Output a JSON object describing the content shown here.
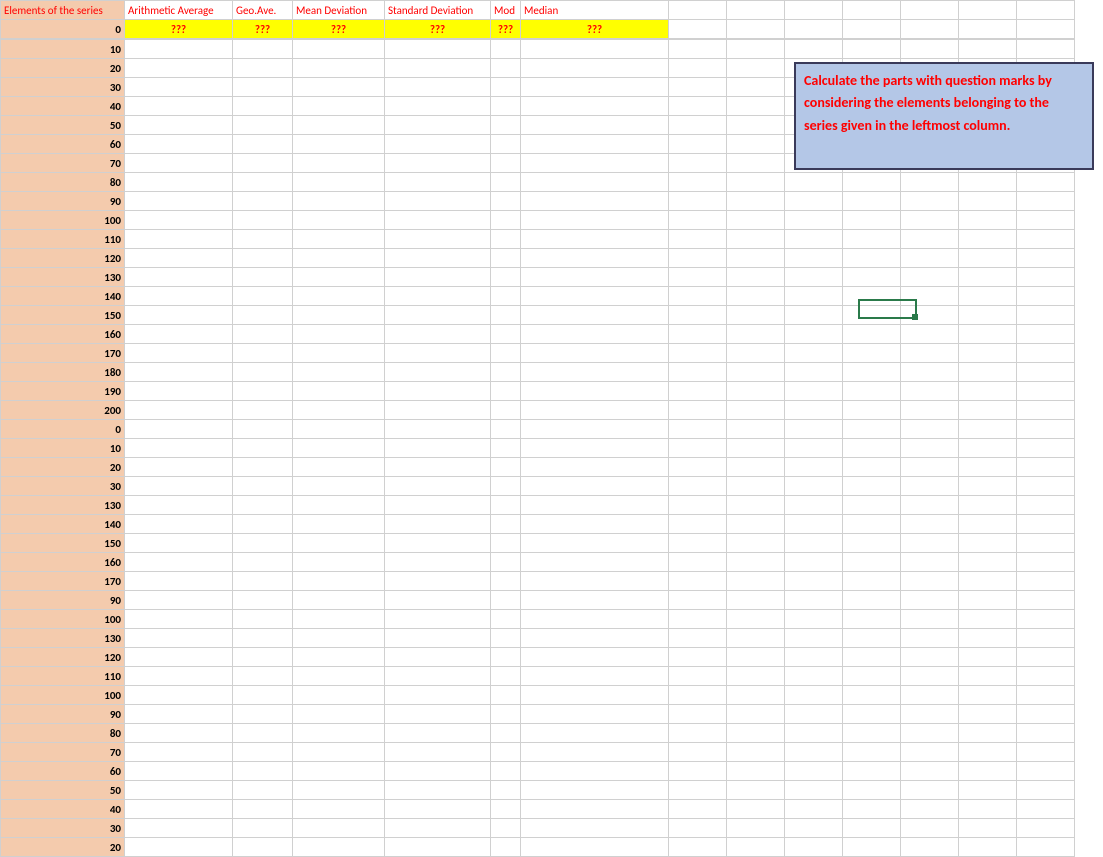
{
  "headers": {
    "col_a": "Elements of the series",
    "col_b": "Arithmetic Average",
    "col_c": "Geo.Ave.",
    "col_d": "Mean Deviation",
    "col_e": "Standard Deviation",
    "col_f": "Mod",
    "col_g": "Median"
  },
  "placeholder": "???",
  "series": [
    0,
    10,
    20,
    30,
    40,
    50,
    60,
    70,
    80,
    90,
    100,
    110,
    120,
    130,
    140,
    150,
    160,
    170,
    180,
    190,
    200,
    0,
    10,
    20,
    30,
    130,
    140,
    150,
    160,
    170,
    90,
    100,
    130,
    120,
    110,
    100,
    90,
    80,
    70,
    60,
    50,
    40,
    30,
    20
  ],
  "instruction": "Calculate the parts with question marks by considering the elements belonging to the series given in the leftmost column."
}
